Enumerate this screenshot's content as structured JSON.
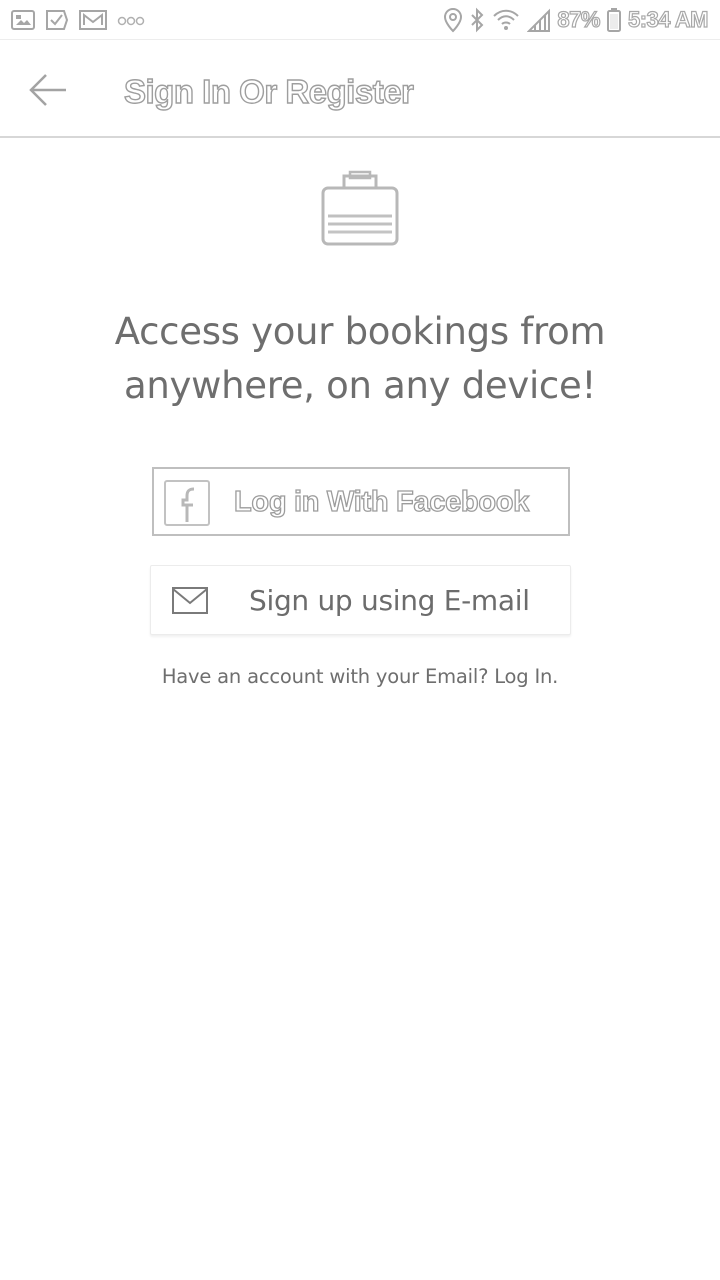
{
  "status_bar": {
    "notification_icons": [
      "image-icon",
      "check-icon",
      "mail-icon",
      "more-icon"
    ],
    "system_icons": [
      "location-icon",
      "bluetooth-icon",
      "wifi-icon",
      "signal-icon"
    ],
    "battery": "87%",
    "time": "5:34 AM"
  },
  "toolbar": {
    "title": "Sign In Or Register"
  },
  "main": {
    "hero_icon": "suitcase-icon",
    "headline_line1": "Access your bookings from",
    "headline_line2": "anywhere, on any device!",
    "facebook_button_label": "Log in With Facebook",
    "email_button_label": "Sign up using E-mail",
    "login_hint": "Have an account with your Email? Log In."
  }
}
